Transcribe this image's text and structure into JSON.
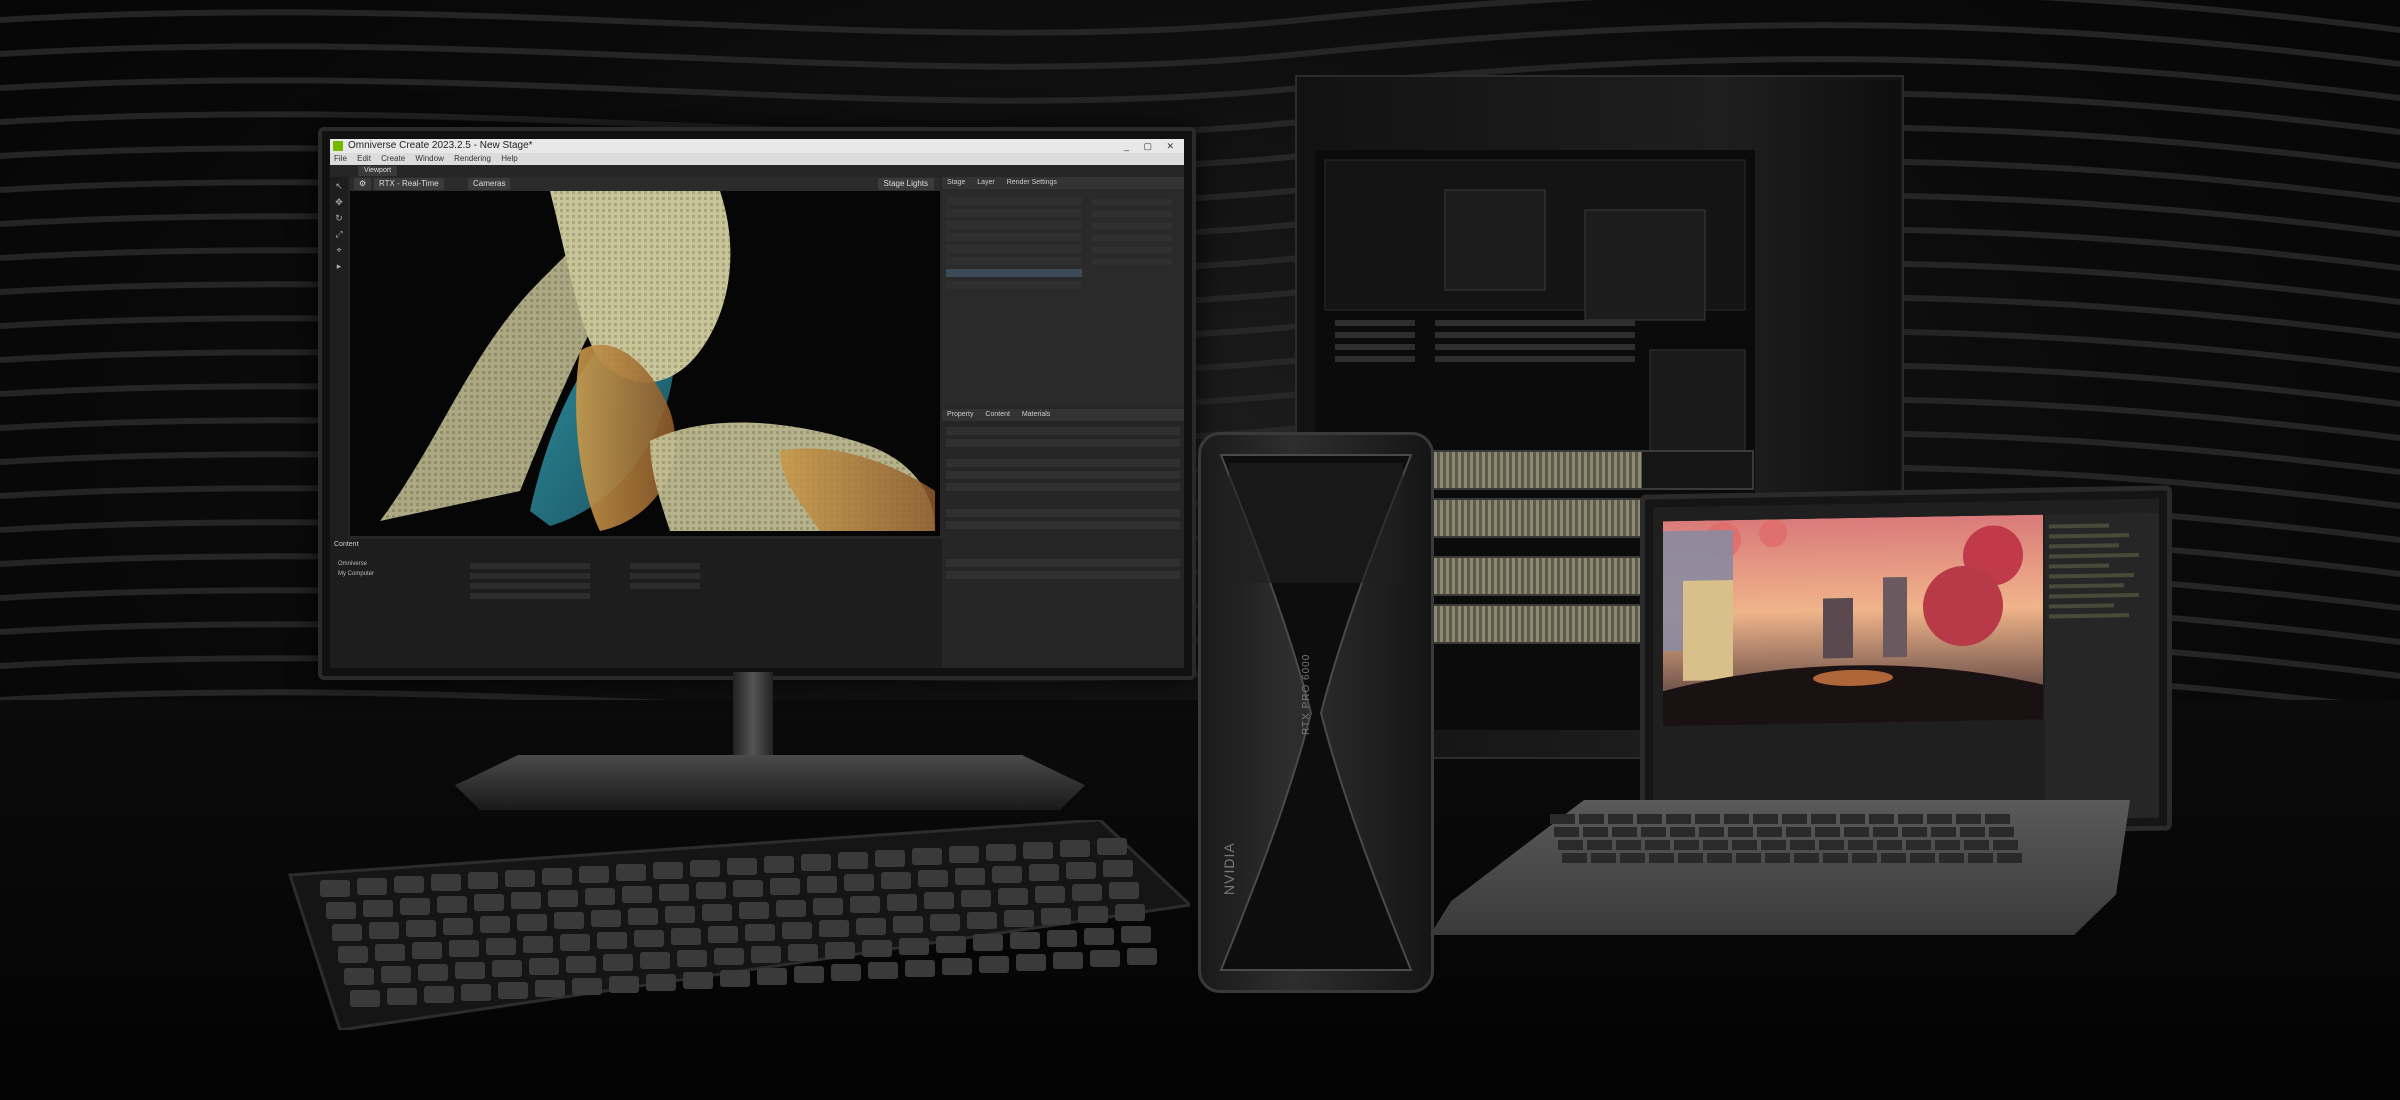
{
  "monitor_app": {
    "window_title": "Omniverse Create 2023.2.5 - New Stage*",
    "menu": [
      "File",
      "Edit",
      "Create",
      "Window",
      "Rendering",
      "Help"
    ],
    "viewport_tab": "Viewport",
    "render_mode": "RTX - Real-Time",
    "camera": "Cameras",
    "lights_button": "Stage Lights",
    "panel_tabs": [
      "Stage",
      "Layer",
      "Render Settings"
    ],
    "property_tabs": [
      "Property",
      "Content",
      "Materials"
    ],
    "bottom_title": "Content",
    "bottom_items": [
      "Omniverse",
      "My Computer"
    ]
  },
  "gpu": {
    "brand_text": "NVIDIA",
    "model_text": "RTX PRO 6000"
  },
  "colors": {
    "nvidia_green": "#76b900",
    "background": "#050505",
    "fabric_light": "#c8c49a",
    "fabric_teal": "#2c7c8c",
    "fabric_rust": "#b8843c"
  }
}
